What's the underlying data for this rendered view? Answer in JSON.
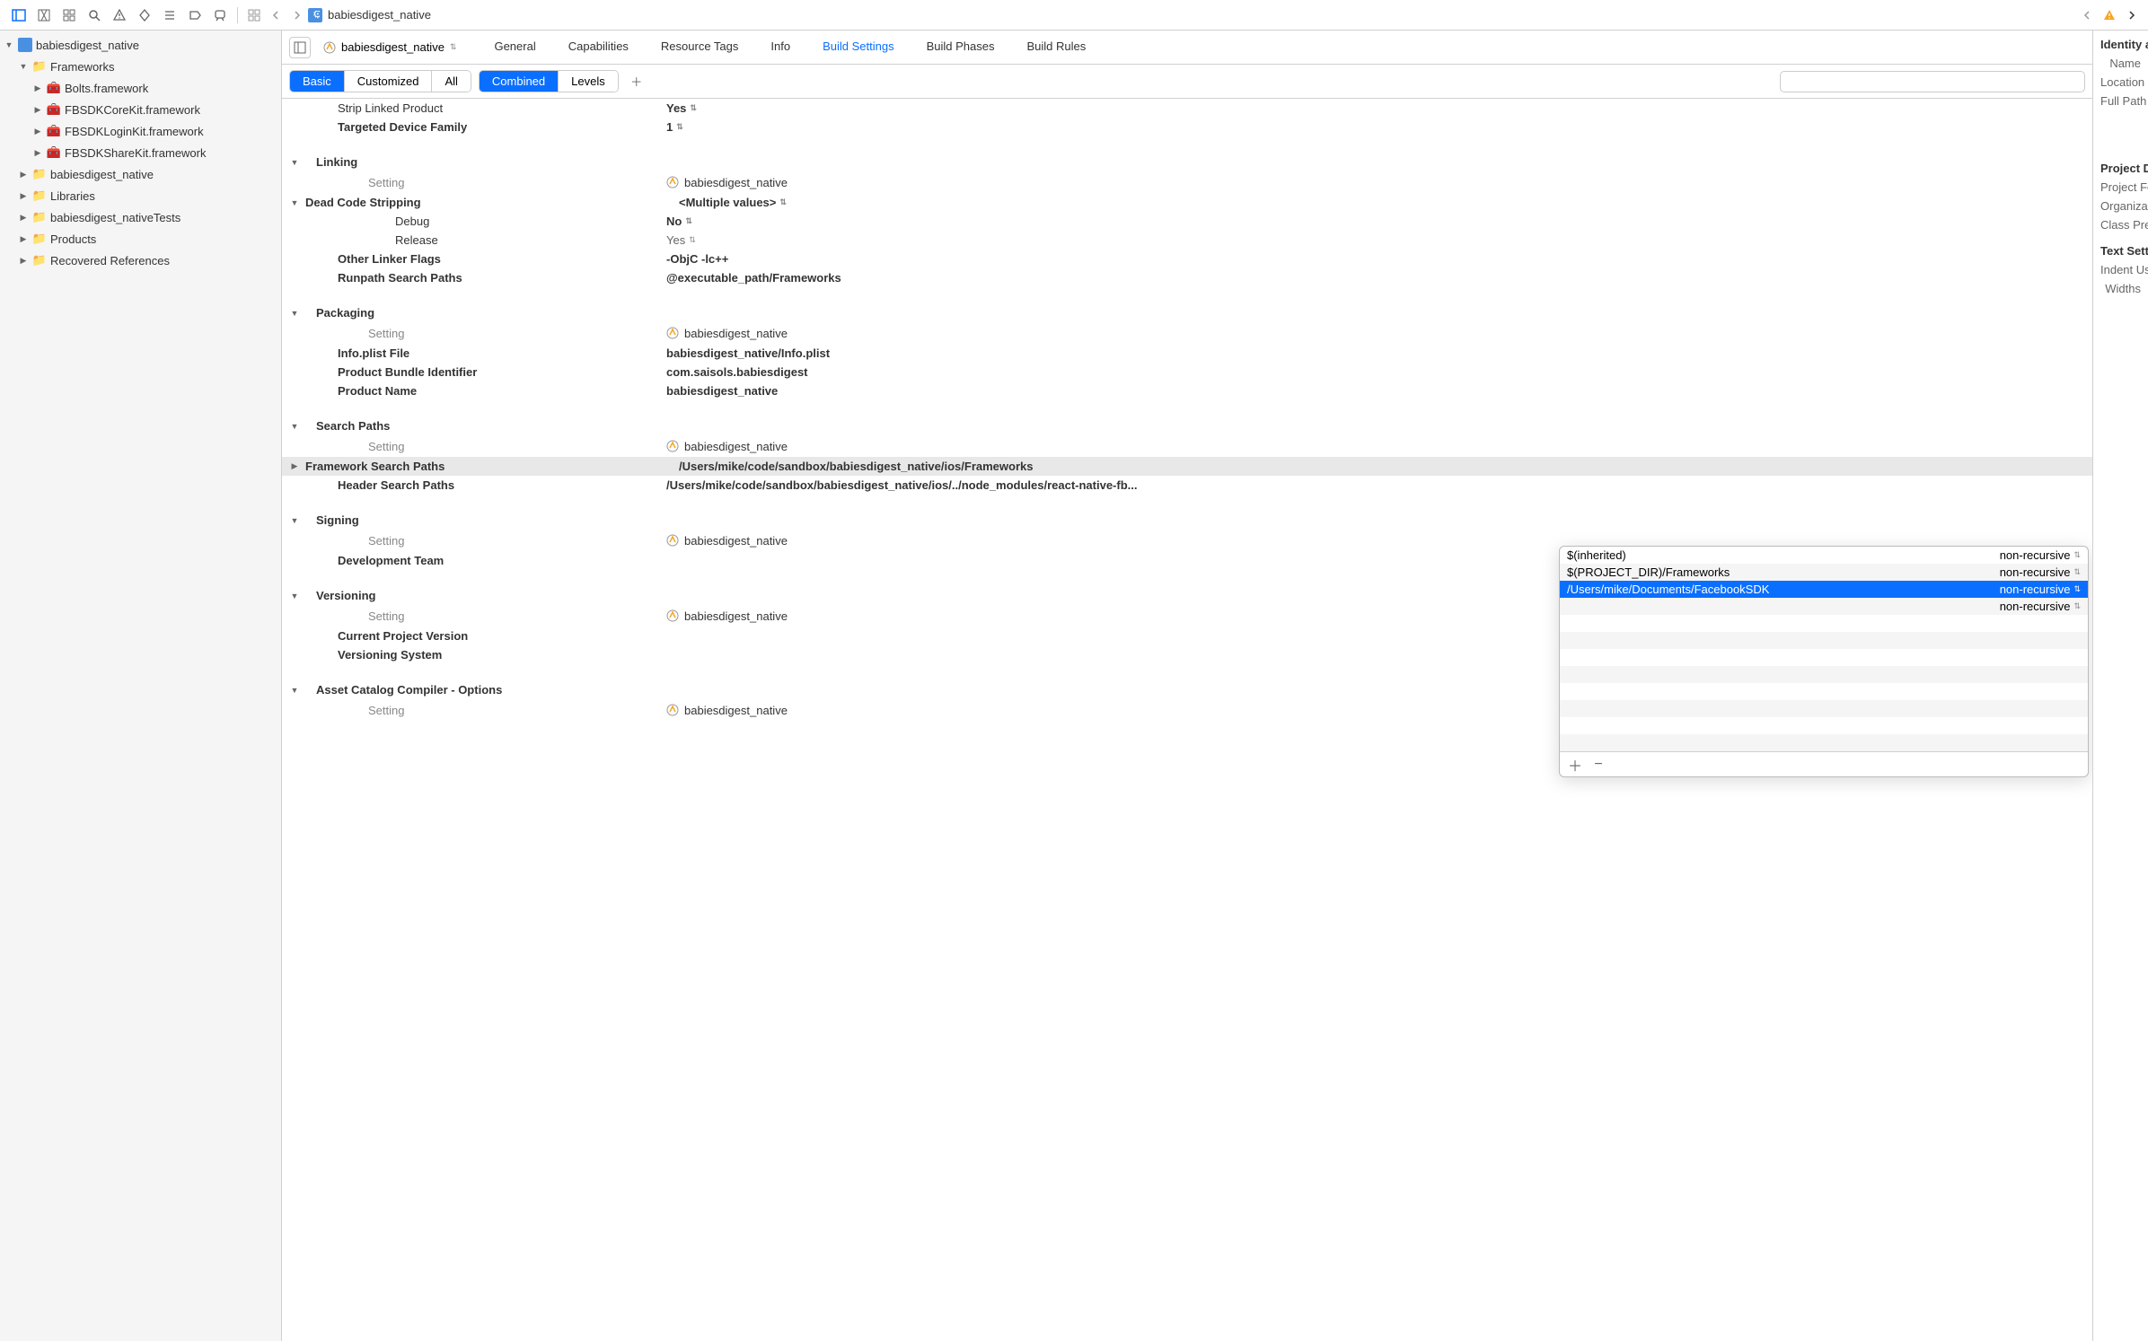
{
  "toolbar": {
    "title": "babiesdigest_native"
  },
  "navigator": {
    "root": "babiesdigest_native",
    "items": [
      {
        "label": "Frameworks",
        "type": "folder",
        "expanded": true,
        "indent": 1,
        "children": [
          {
            "label": "Bolts.framework",
            "type": "fw",
            "indent": 2
          },
          {
            "label": "FBSDKCoreKit.framework",
            "type": "fw",
            "indent": 2
          },
          {
            "label": "FBSDKLoginKit.framework",
            "type": "fw",
            "indent": 2
          },
          {
            "label": "FBSDKShareKit.framework",
            "type": "fw",
            "indent": 2
          }
        ]
      },
      {
        "label": "babiesdigest_native",
        "type": "folder",
        "expanded": false,
        "indent": 1
      },
      {
        "label": "Libraries",
        "type": "folder",
        "expanded": false,
        "indent": 1
      },
      {
        "label": "babiesdigest_nativeTests",
        "type": "folder",
        "expanded": false,
        "indent": 1
      },
      {
        "label": "Products",
        "type": "folder",
        "expanded": false,
        "indent": 1
      },
      {
        "label": "Recovered References",
        "type": "folder",
        "expanded": false,
        "indent": 1
      }
    ]
  },
  "tabs": {
    "target": "babiesdigest_native",
    "items": [
      "General",
      "Capabilities",
      "Resource Tags",
      "Info",
      "Build Settings",
      "Build Phases",
      "Build Rules"
    ],
    "active": "Build Settings"
  },
  "filter": {
    "scope": [
      "Basic",
      "Customized",
      "All"
    ],
    "scope_active": "Basic",
    "view": [
      "Combined",
      "Levels"
    ],
    "view_active": "Combined",
    "search_placeholder": ""
  },
  "settings": {
    "col_setting": "Setting",
    "col_target": "babiesdigest_native",
    "top": [
      {
        "label": "Strip Linked Product",
        "value": "Yes",
        "popup": true
      },
      {
        "label": "Targeted Device Family",
        "value": "1",
        "popup": true
      }
    ],
    "sections": [
      {
        "name": "Linking",
        "rows": [
          {
            "label": "Dead Code Stripping",
            "value": "<Multiple values>",
            "popup": true,
            "expanded": true,
            "children": [
              {
                "label": "Debug",
                "value": "No",
                "popup": true
              },
              {
                "label": "Release",
                "value": "Yes",
                "popup": true
              }
            ]
          },
          {
            "label": "Other Linker Flags",
            "value": "-ObjC -lc++"
          },
          {
            "label": "Runpath Search Paths",
            "value": "@executable_path/Frameworks"
          }
        ]
      },
      {
        "name": "Packaging",
        "rows": [
          {
            "label": "Info.plist File",
            "value": "babiesdigest_native/Info.plist"
          },
          {
            "label": "Product Bundle Identifier",
            "value": "com.saisols.babiesdigest"
          },
          {
            "label": "Product Name",
            "value": "babiesdigest_native"
          }
        ]
      },
      {
        "name": "Search Paths",
        "rows": [
          {
            "label": "Framework Search Paths",
            "value": "/Users/mike/code/sandbox/babiesdigest_native/ios/Frameworks",
            "highlighted": true,
            "collapsed": true
          },
          {
            "label": "Header Search Paths",
            "value": "/Users/mike/code/sandbox/babiesdigest_native/ios/../node_modules/react-native-fb..."
          }
        ]
      },
      {
        "name": "Signing",
        "rows": [
          {
            "label": "Development Team",
            "value": ""
          }
        ]
      },
      {
        "name": "Versioning",
        "rows": [
          {
            "label": "Current Project Version",
            "value": ""
          },
          {
            "label": "Versioning System",
            "value": ""
          }
        ]
      },
      {
        "name": "Asset Catalog Compiler - Options",
        "rows": []
      }
    ]
  },
  "popover": {
    "rows": [
      {
        "path": "$(inherited)",
        "recursive": "non-recursive",
        "selected": false
      },
      {
        "path": "$(PROJECT_DIR)/Frameworks",
        "recursive": "non-recursive",
        "selected": false
      },
      {
        "path": "/Users/mike/Documents/FacebookSDK",
        "recursive": "non-recursive",
        "selected": true
      },
      {
        "path": "",
        "recursive": "non-recursive",
        "selected": false
      }
    ]
  },
  "inspector": {
    "identity_header": "Identity and Type",
    "name_label": "Name",
    "location_label": "Location",
    "fullpath_label": "Full Path",
    "projdoc_header": "Project Document",
    "projformat_label": "Project Format",
    "org_label": "Organization",
    "classprefix_label": "Class Prefix",
    "textsettings_header": "Text Settings",
    "indent_label": "Indent Using",
    "widths_label": "Widths"
  }
}
